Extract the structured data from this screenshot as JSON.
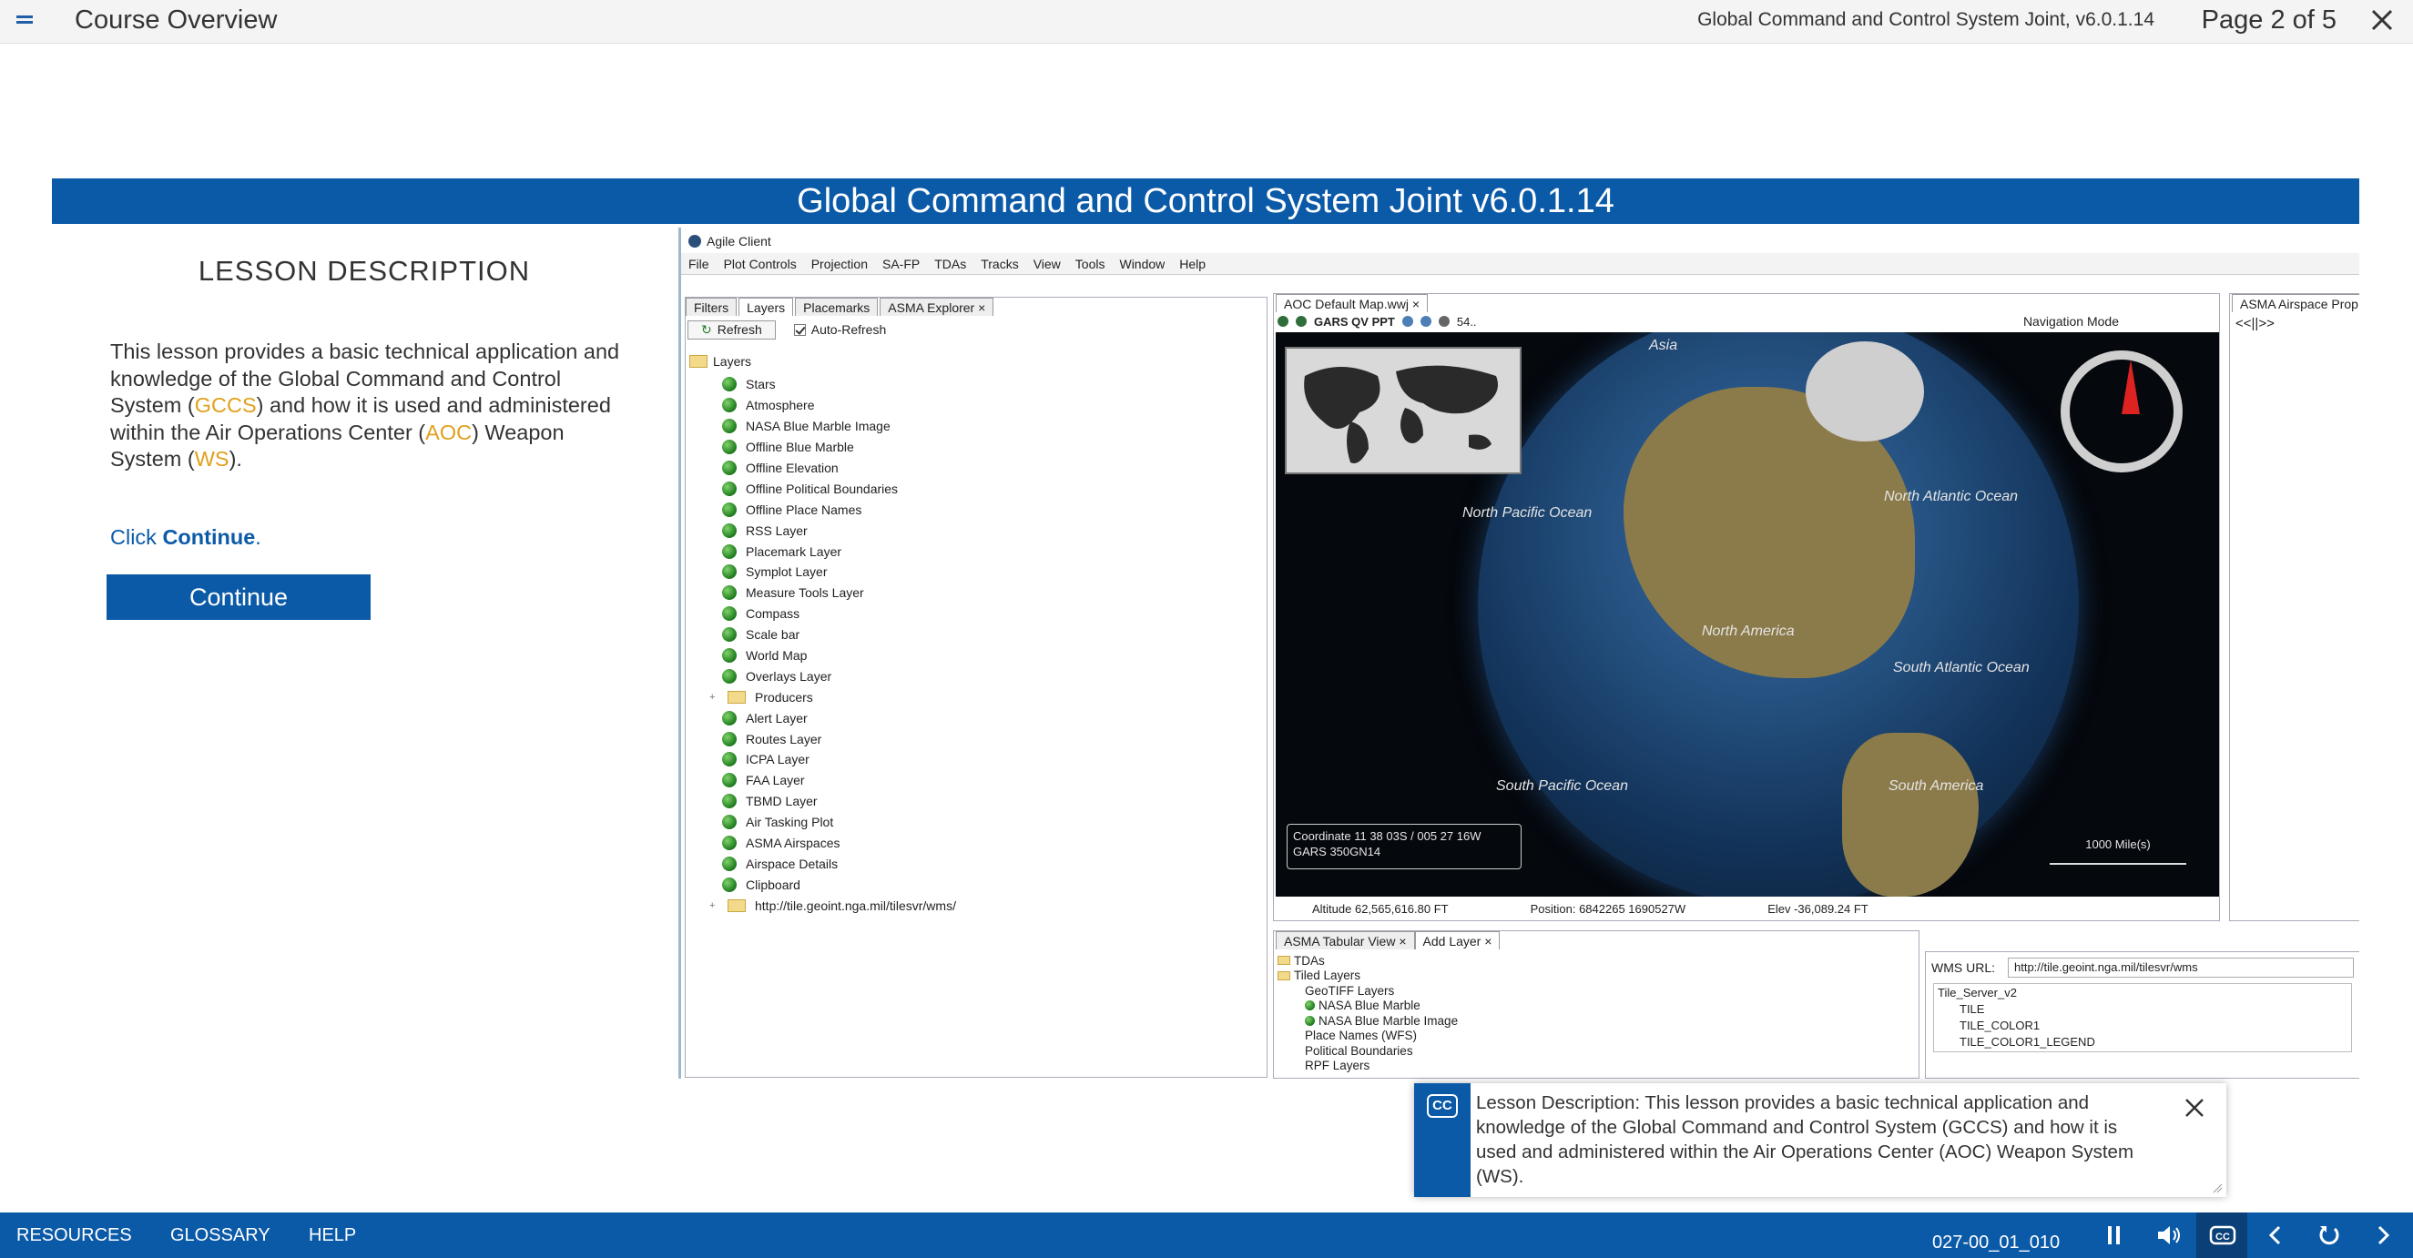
{
  "topbar": {
    "course_title": "Course Overview",
    "subtitle": "Global Command and Control System Joint, v6.0.1.14",
    "page_indicator": "Page 2 of 5"
  },
  "slide": {
    "banner": "Global Command and Control System Joint v6.0.1.14",
    "lesson_heading": "LESSON DESCRIPTION",
    "lesson_text": {
      "p1": "This lesson provides a basic technical application and knowledge of the Global Command and Control System (",
      "gccs": "GCCS",
      "p2": ") and how it is used and administered within the Air Operations Center (",
      "aoc": "AOC",
      "p3": ") Weapon System (",
      "ws": "WS",
      "p4": ")."
    },
    "click_prefix": "Click ",
    "click_bold": "Continue",
    "click_suffix": ".",
    "continue_label": "Continue"
  },
  "screenshot": {
    "window_title": "Agile Client",
    "menu": [
      "File",
      "Plot Controls",
      "Projection",
      "SA-FP",
      "TDAs",
      "Tracks",
      "View",
      "Tools",
      "Window",
      "Help"
    ],
    "left_tabs": [
      "Filters",
      "Layers",
      "Placemarks",
      "ASMA Explorer ×"
    ],
    "refresh_label": "Refresh",
    "auto_refresh_label": "Auto-Refresh",
    "layers_root": "Layers",
    "layers": [
      "Stars",
      "Atmosphere",
      "NASA Blue Marble Image",
      "Offline Blue Marble",
      "Offline Elevation",
      "Offline Political Boundaries",
      "Offline Place Names",
      "RSS Layer",
      "Placemark Layer",
      "Symplot Layer",
      "Measure Tools Layer",
      "Compass",
      "Scale bar",
      "World Map",
      "Overlays Layer",
      "Producers",
      "Alert Layer",
      "Routes Layer",
      "ICPA Layer",
      "FAA Layer",
      "TBMD Layer",
      "Air Tasking Plot",
      "ASMA Airspaces",
      "Airspace Details",
      "Clipboard",
      "http://tile.geoint.nga.mil/tilesvr/wms/"
    ],
    "map_tab": "AOC Default Map.wwj ×",
    "map_toolbar_text": "GARS QV PPT",
    "map_toolbar_num": "54..",
    "nav_mode": "Navigation Mode",
    "map_labels": {
      "asia": "Asia",
      "north_pacific": "North Pacific Ocean",
      "north_atlantic": "North Atlantic Ocean",
      "north_america": "North America",
      "south_atlantic": "South Atlantic Ocean",
      "south_pacific": "South Pacific Ocean",
      "south_america": "South America"
    },
    "coord_line1": "Coordinate 11 38 03S / 005 27 16W",
    "coord_line2": "GARS 350GN14",
    "scale_label": "1000 Mile(s)",
    "status_altitude": "Altitude 62,565,616.80 FT",
    "status_position": "Position: 6842265 1690527W",
    "status_elev": "Elev -36,089.24 FT",
    "airspace_tab": "ASMA Airspace Prop",
    "airspace_nav": "<<||>>",
    "bottom_tabs": [
      "ASMA Tabular View ×",
      "Add Layer ×"
    ],
    "bottom_tree": [
      "TDAs",
      "Tiled Layers",
      "GeoTIFF Layers",
      "NASA Blue Marble",
      "NASA Blue Marble Image",
      "Place Names (WFS)",
      "Political Boundaries",
      "RPF Layers"
    ],
    "wms_label": "WMS URL:",
    "wms_url": "http://tile.geoint.nga.mil/tilesvr/wms",
    "wms_tree": [
      "Tile_Server_v2",
      "TILE",
      "TILE_COLOR1",
      "TILE_COLOR1_LEGEND"
    ]
  },
  "caption": {
    "cc_label": "CC",
    "text": "Lesson Description: This lesson provides a basic technical application and knowledge of the Global Command and Control System (GCCS) and how it is used and administered within the Air Operations Center (AOC) Weapon System (WS)."
  },
  "bottombar": {
    "resources": "RESOURCES",
    "glossary": "GLOSSARY",
    "help": "HELP",
    "slide_code": "027-00_01_010"
  },
  "colors": {
    "brand_blue": "#0b5aa8",
    "highlight": "#e0a01c"
  },
  "icons": [
    "menu-icon",
    "close-icon",
    "cc-icon",
    "pause-icon",
    "volume-icon",
    "back-icon",
    "replay-icon",
    "next-icon"
  ]
}
